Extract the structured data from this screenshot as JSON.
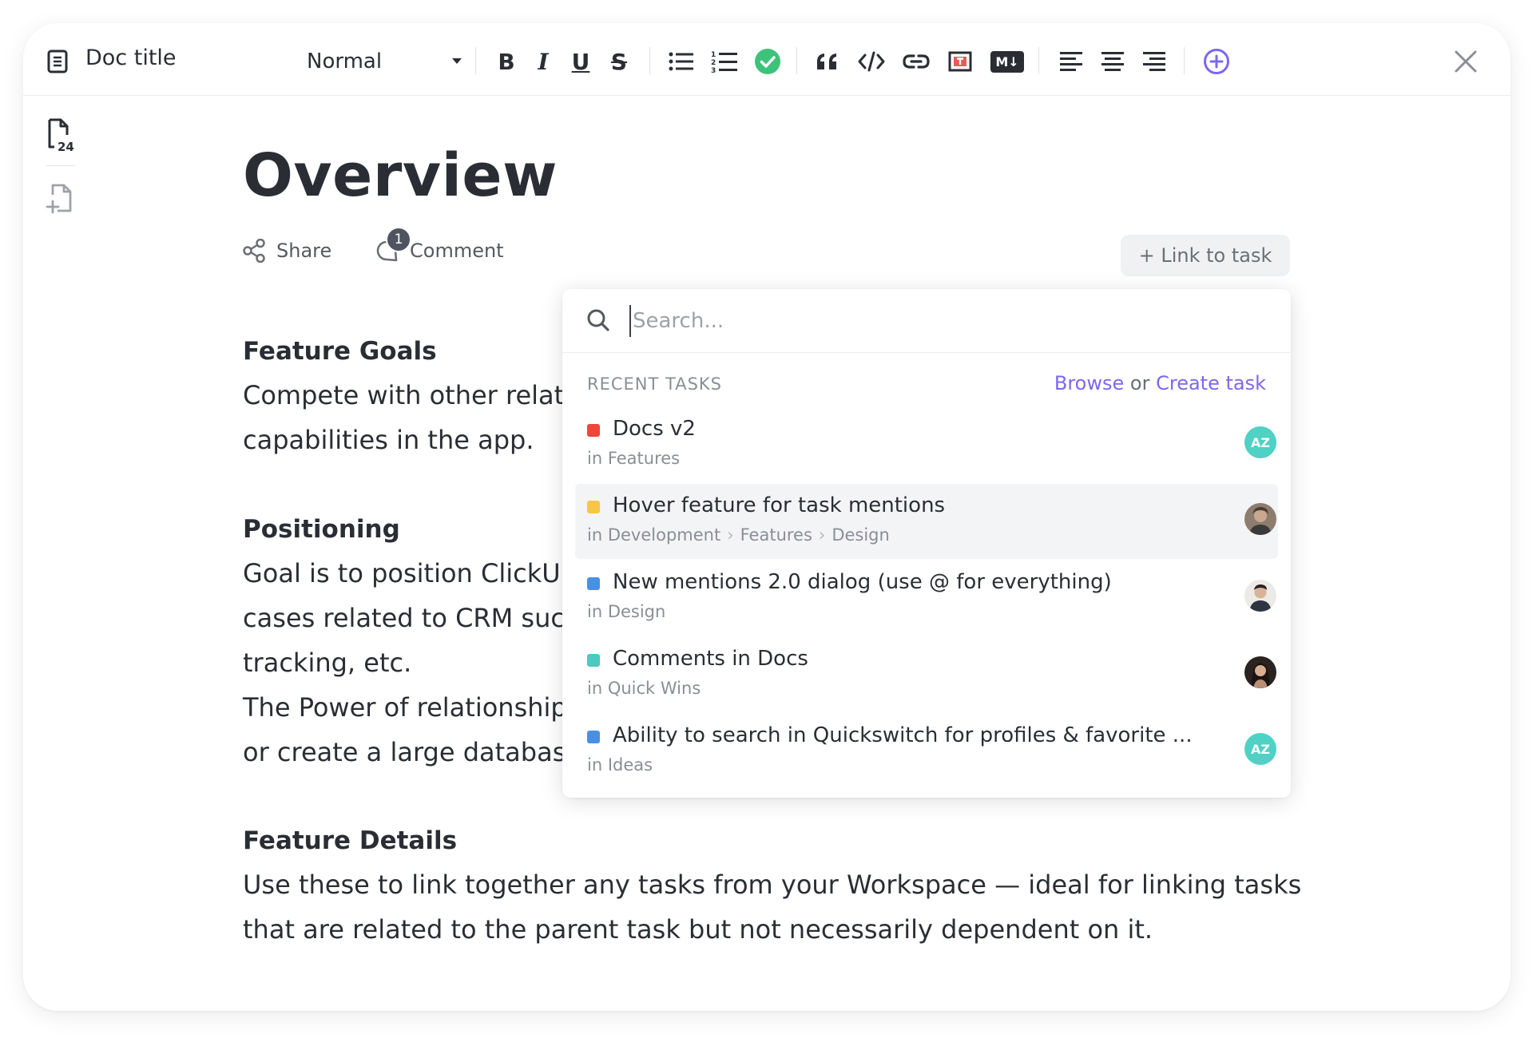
{
  "toolbar": {
    "doc_title": "Doc title",
    "style_select": "Normal",
    "bold": "B",
    "italic": "I",
    "underline": "U",
    "strike": "S",
    "markdown": "M↓"
  },
  "rail": {
    "page_count": "24"
  },
  "doc": {
    "title": "Overview",
    "share_label": "Share",
    "comment_label": "Comment",
    "comment_count": "1",
    "link_task_label": "+ Link to task",
    "sections": [
      {
        "heading": "Feature Goals",
        "lines": [
          "Compete with other relat",
          "capabilities in the app."
        ]
      },
      {
        "heading": "Positioning",
        "lines": [
          "Goal is to position ClickU",
          "cases related to CRM such",
          "tracking, etc.",
          "The Power of relationship",
          "or create a large database"
        ]
      },
      {
        "heading": "Feature Details",
        "lines": [
          "Use these to link together any tasks from your Workspace — ideal for linking tasks",
          "that are related to the parent task but not necessarily dependent on it."
        ]
      }
    ]
  },
  "panel": {
    "search_placeholder": "Search...",
    "recent_header": "RECENT TASKS",
    "browse_label": "Browse",
    "or_label": "or",
    "create_label": "Create task",
    "tasks": [
      {
        "title": "Docs v2",
        "path": [
          "in Features"
        ],
        "status_color": "#f0453a",
        "avatar": "AZ"
      },
      {
        "title": "Hover feature for task mentions",
        "path": [
          "in Development",
          "Features",
          "Design"
        ],
        "status_color": "#f7c644",
        "avatar": ""
      },
      {
        "title": "New mentions 2.0 dialog (use @ for everything)",
        "path": [
          "in Design"
        ],
        "status_color": "#4a90e2",
        "avatar": ""
      },
      {
        "title": "Comments in Docs",
        "path": [
          "in Quick Wins"
        ],
        "status_color": "#4cc9c0",
        "avatar": ""
      },
      {
        "title": "Ability to search in Quickswitch for profiles & favorite ...",
        "path": [
          "in Ideas"
        ],
        "status_color": "#4a90e2",
        "avatar": "AZ"
      }
    ]
  },
  "colors": {
    "accent": "#7b68ee",
    "check": "#3ec27a",
    "avatar_az": "#4fd1c5"
  }
}
